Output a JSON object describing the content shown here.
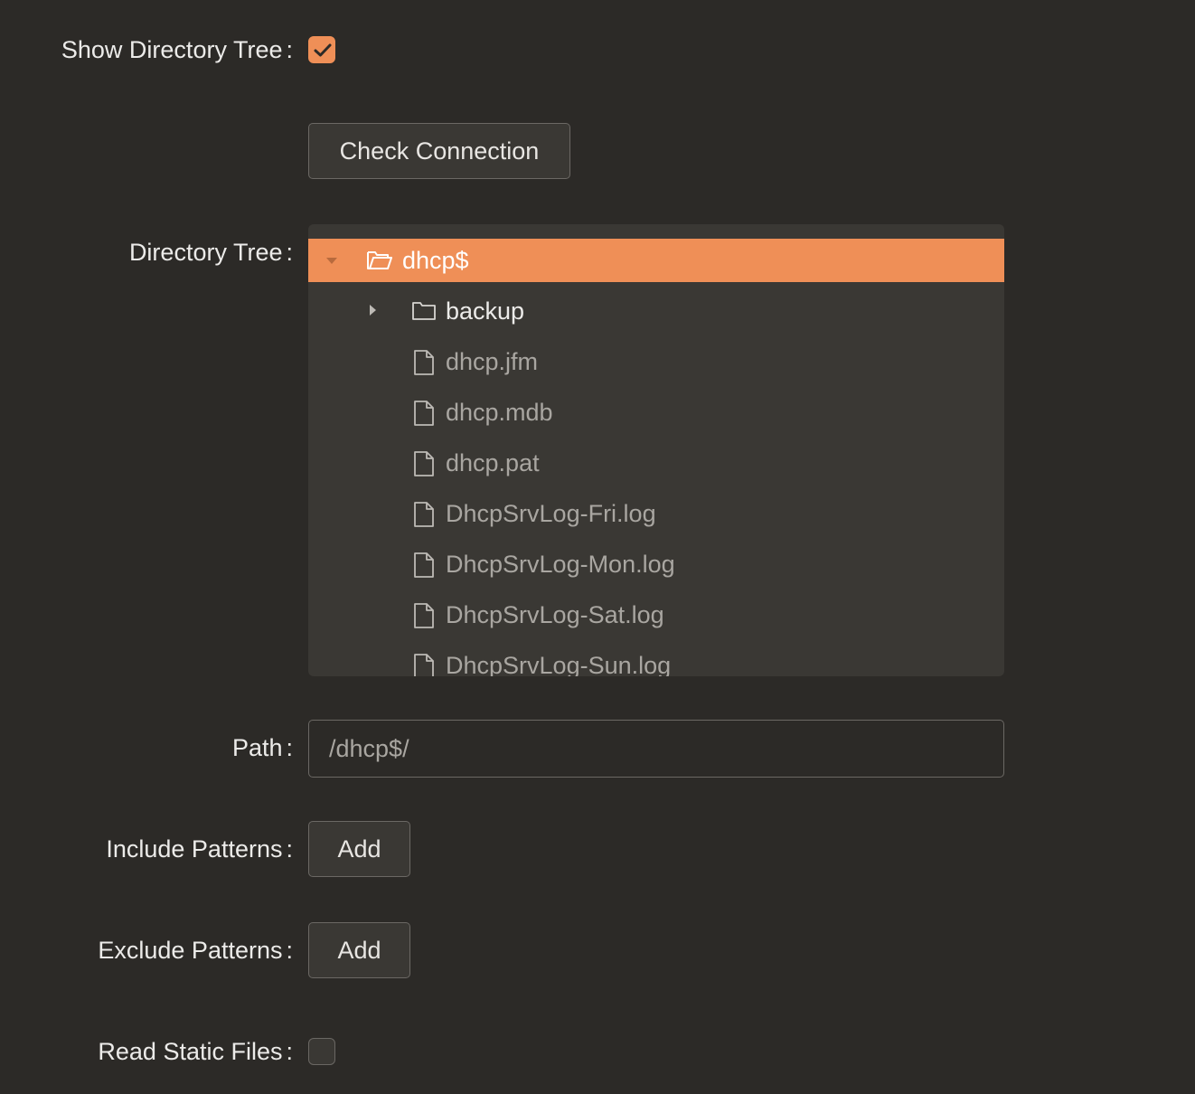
{
  "form": {
    "show_directory_tree": {
      "label": "Show Directory Tree",
      "colon": ":",
      "checked": true
    },
    "check_connection": {
      "label": "Check Connection"
    },
    "directory_tree": {
      "label": "Directory Tree",
      "colon": ":",
      "root": {
        "name": "dhcp$",
        "expanded": true,
        "selected": true,
        "icon": "folder-open-icon"
      },
      "children": [
        {
          "name": "backup",
          "type": "folder",
          "expanded": false,
          "icon": "folder-icon"
        },
        {
          "name": "dhcp.jfm",
          "type": "file",
          "icon": "file-icon"
        },
        {
          "name": "dhcp.mdb",
          "type": "file",
          "icon": "file-icon"
        },
        {
          "name": "dhcp.pat",
          "type": "file",
          "icon": "file-icon"
        },
        {
          "name": "DhcpSrvLog-Fri.log",
          "type": "file",
          "icon": "file-icon"
        },
        {
          "name": "DhcpSrvLog-Mon.log",
          "type": "file",
          "icon": "file-icon"
        },
        {
          "name": "DhcpSrvLog-Sat.log",
          "type": "file",
          "icon": "file-icon"
        },
        {
          "name": "DhcpSrvLog-Sun.log",
          "type": "file",
          "icon": "file-icon"
        }
      ]
    },
    "path": {
      "label": "Path",
      "colon": ":",
      "value": "/dhcp$/"
    },
    "include_patterns": {
      "label": "Include Patterns",
      "colon": ":",
      "button": "Add"
    },
    "exclude_patterns": {
      "label": "Exclude Patterns",
      "colon": ":",
      "button": "Add"
    },
    "read_static_files": {
      "label": "Read Static Files",
      "colon": ":",
      "checked": false
    }
  },
  "colors": {
    "background": "#2c2a27",
    "panel": "#3a3834",
    "accent": "#ef8f57",
    "text": "#e8e6e3",
    "muted_text": "#a9a6a1",
    "border": "#6b6864"
  }
}
